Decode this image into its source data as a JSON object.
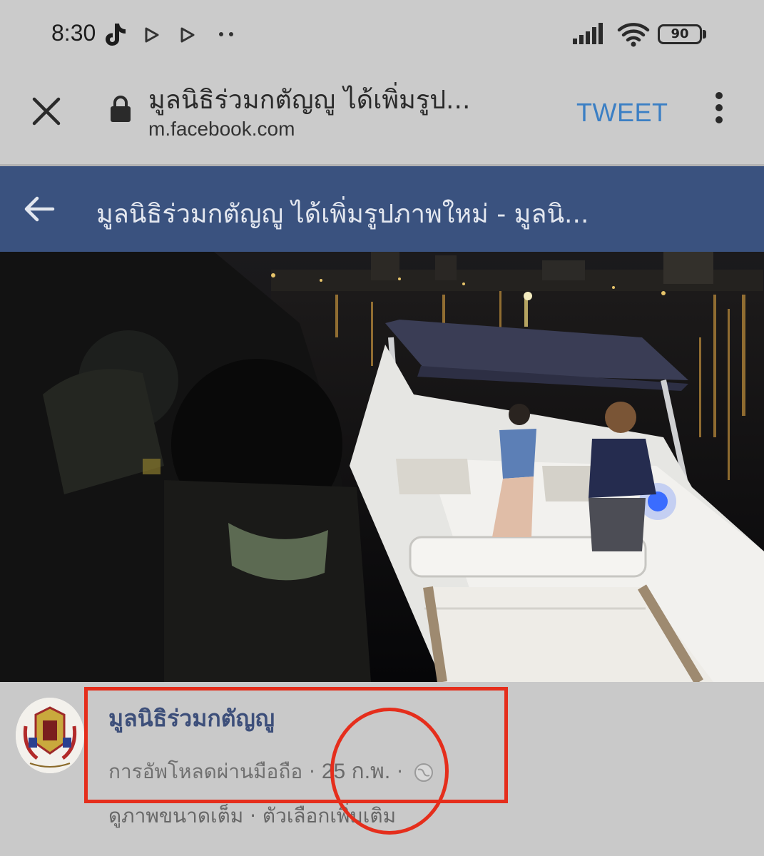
{
  "status_bar": {
    "time": "8:30",
    "battery": "90",
    "icons": [
      "tiktok-icon",
      "play-store-icon",
      "play-store-icon",
      "more-dots-icon",
      "signal-icon",
      "wifi-icon",
      "battery-icon"
    ]
  },
  "browser": {
    "title": "มูลนิธิร่วมกตัญญู ได้เพิ่มรูป...",
    "url": "m.facebook.com",
    "tweet_label": "TWEET",
    "accent": "#3b7fc4"
  },
  "fb_header": {
    "title": "มูลนิธิร่วมกตัญญู ได้เพิ่มรูปภาพใหม่ - มูลนิ...",
    "color": "#3a527f"
  },
  "post": {
    "page_name": "มูลนิธิร่วมกตัญญู",
    "meta_prefix": "การอัพโหลดผ่านมือถือ · ",
    "date": "25 ก.พ.",
    "meta_suffix": " ·",
    "view_full": "ดูภาพขนาดเต็ม",
    "separator": " · ",
    "more_options": "ตัวเลือกเพิ่มเติม"
  },
  "annotation": {
    "color": "#e52e1c"
  }
}
